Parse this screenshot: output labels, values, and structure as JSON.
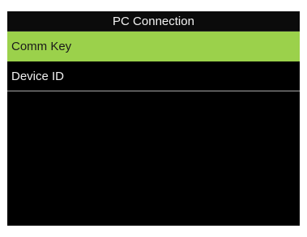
{
  "screen": {
    "title": "PC Connection",
    "items": [
      {
        "label": "Comm Key",
        "selected": true
      },
      {
        "label": "Device ID",
        "selected": false
      }
    ]
  },
  "colors": {
    "selected_background": "#9bd14b",
    "screen_background": "#000000",
    "text": "#f0f0f0"
  }
}
